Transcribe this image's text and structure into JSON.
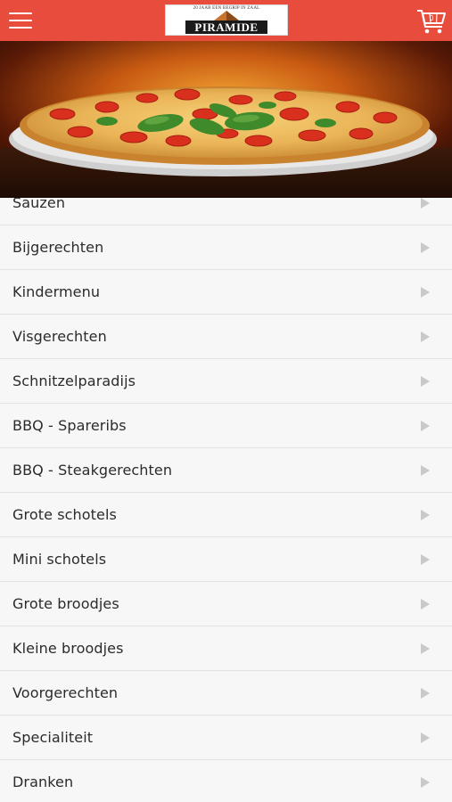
{
  "header": {
    "menu_icon": "hamburger-icon",
    "logo": {
      "tagline": "20 JAAR EEN BEGRIP IN ZAAL",
      "name": "PIRAMIDE"
    },
    "cart": {
      "icon": "cart-icon",
      "count": "0"
    },
    "colors": {
      "header": "#e74c3c",
      "logo_bg": "#ffffff"
    }
  },
  "hero": {
    "image": "pizza-photo"
  },
  "menu": {
    "items": [
      {
        "label": "Sauzen"
      },
      {
        "label": "Bijgerechten"
      },
      {
        "label": "Kindermenu"
      },
      {
        "label": "Visgerechten"
      },
      {
        "label": "Schnitzelparadijs"
      },
      {
        "label": "BBQ - Spareribs"
      },
      {
        "label": "BBQ - Steakgerechten"
      },
      {
        "label": "Grote schotels"
      },
      {
        "label": "Mini schotels"
      },
      {
        "label": "Grote broodjes"
      },
      {
        "label": "Kleine broodjes"
      },
      {
        "label": "Voorgerechten"
      },
      {
        "label": "Specialiteit"
      },
      {
        "label": "Dranken"
      }
    ],
    "arrow_icon": "chevron-right-icon"
  }
}
